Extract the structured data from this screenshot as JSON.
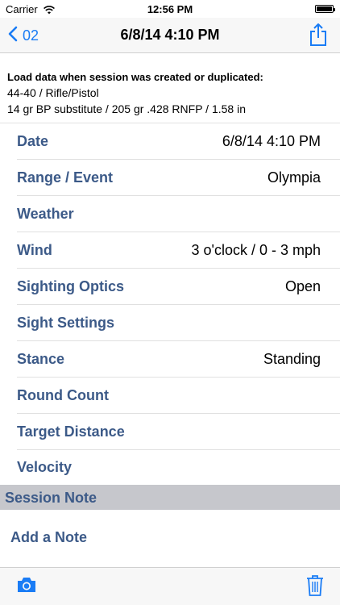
{
  "status_bar": {
    "carrier": "Carrier",
    "time": "12:56 PM"
  },
  "nav": {
    "back_label": "02",
    "title": "6/8/14 4:10 PM",
    "tint_color": "#1a7cf5"
  },
  "load_data": {
    "heading": "Load data when session was created or duplicated:",
    "line1": "44-40 / Rifle/Pistol",
    "line2": "14 gr BP substitute / 205 gr .428 RNFP / 1.58 in"
  },
  "rows": [
    {
      "label": "Date",
      "value": "6/8/14 4:10 PM"
    },
    {
      "label": "Range / Event",
      "value": "Olympia"
    },
    {
      "label": "Weather",
      "value": ""
    },
    {
      "label": "Wind",
      "value": "3 o'clock / 0 - 3 mph"
    },
    {
      "label": "Sighting Optics",
      "value": "Open"
    },
    {
      "label": "Sight Settings",
      "value": ""
    },
    {
      "label": "Stance",
      "value": "Standing"
    },
    {
      "label": "Round Count",
      "value": ""
    },
    {
      "label": "Target Distance",
      "value": ""
    },
    {
      "label": "Velocity",
      "value": ""
    }
  ],
  "session_note": {
    "header": "Session Note",
    "add_label": "Add a Note"
  },
  "toolbar": {
    "camera_icon": "camera-icon",
    "trash_icon": "trash-icon"
  },
  "colors": {
    "label": "#3c5a88",
    "section_bg": "#c6c7cc"
  }
}
